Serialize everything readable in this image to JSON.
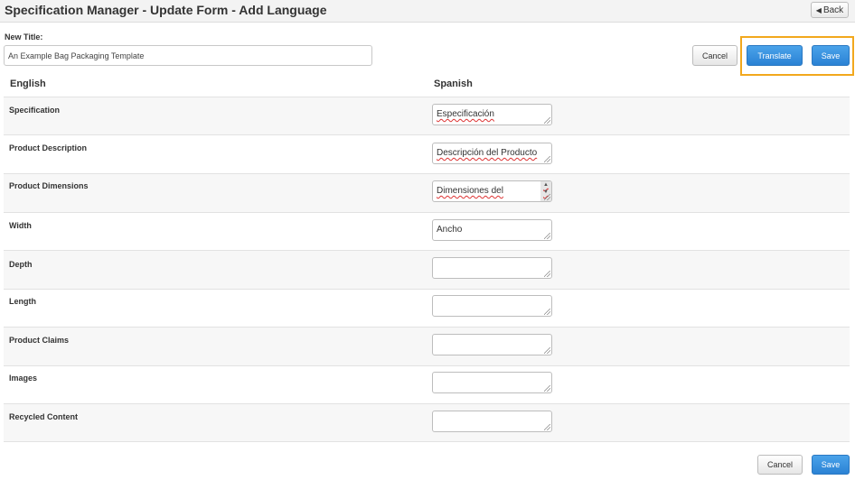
{
  "header": {
    "title": "Specification Manager - Update Form - Add Language",
    "back_label": "Back"
  },
  "form": {
    "new_title_label": "New Title:",
    "new_title_value": "An Example Bag Packaging Template"
  },
  "actions": {
    "cancel_label": "Cancel",
    "translate_label": "Translate",
    "save_label": "Save",
    "highlight_color": "#f2a81d",
    "primary_color": "#2b82d4"
  },
  "columns": {
    "source": "English",
    "target": "Spanish"
  },
  "rows": [
    {
      "label": "Specification",
      "value": "Especificación"
    },
    {
      "label": "Product Description",
      "value": "Descripción del Producto"
    },
    {
      "label": "Product Dimensions",
      "value": "Dimensiones del"
    },
    {
      "label": "Width",
      "value": "Ancho"
    },
    {
      "label": "Depth",
      "value": ""
    },
    {
      "label": "Length",
      "value": ""
    },
    {
      "label": "Product Claims",
      "value": ""
    },
    {
      "label": "Images",
      "value": ""
    },
    {
      "label": "Recycled Content",
      "value": ""
    }
  ],
  "footer": {
    "cancel_label": "Cancel",
    "save_label": "Save"
  }
}
